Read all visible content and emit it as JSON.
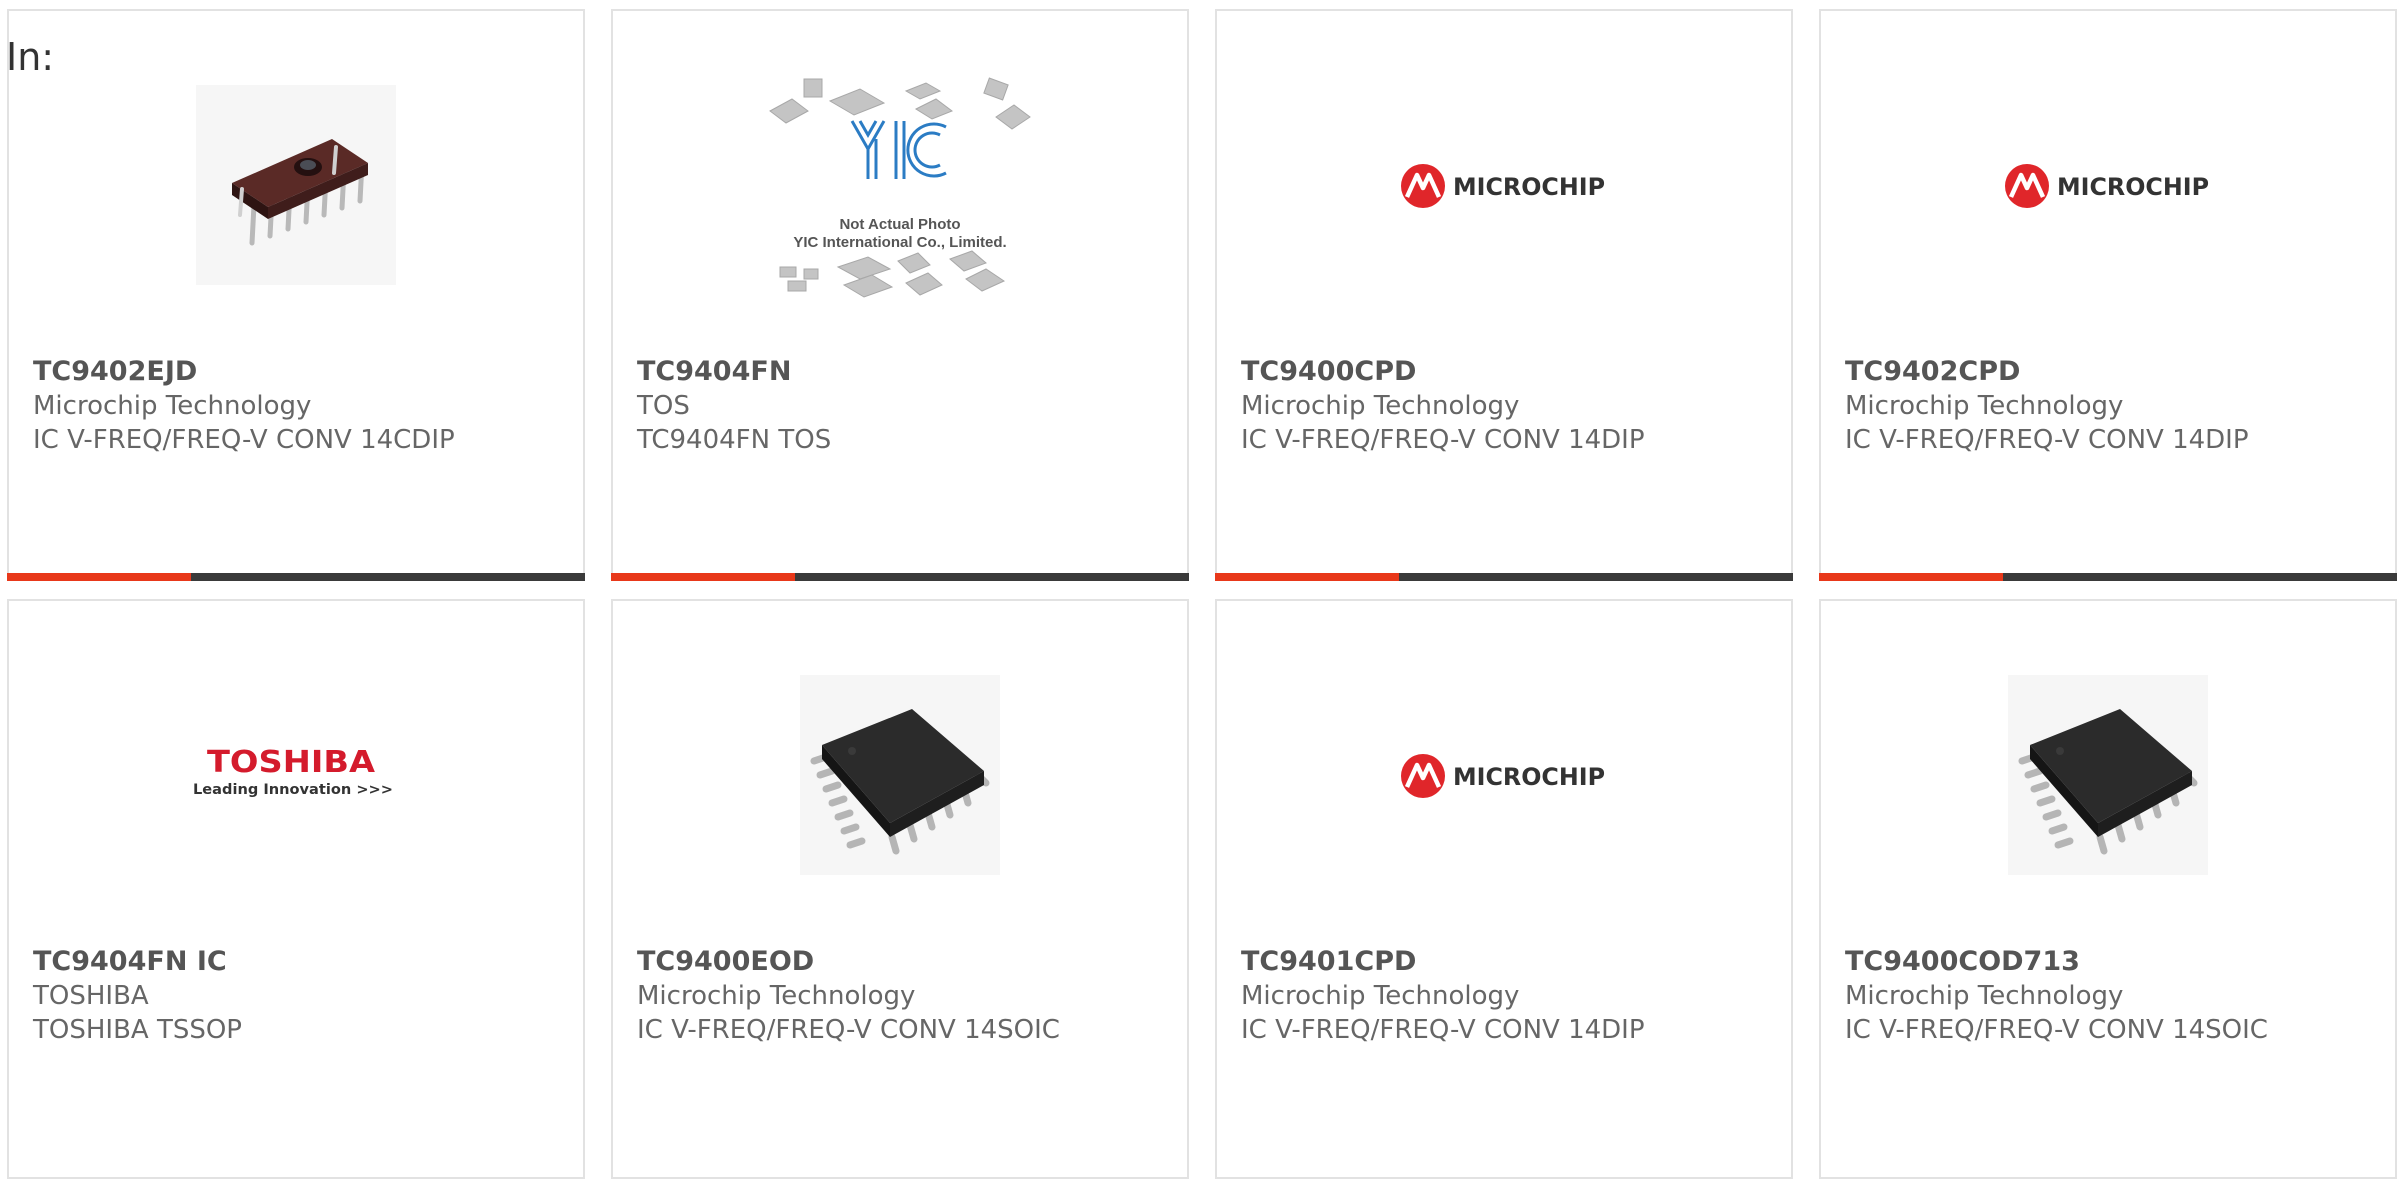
{
  "header": {
    "in_label": "In:"
  },
  "colors": {
    "accent": "#e8381a",
    "bar_dark": "#3a3a3a",
    "microchip_red": "#e0262a",
    "toshiba_red": "#d41b2c"
  },
  "products": [
    {
      "part": "TC9402EJD",
      "manufacturer": "Microchip Technology",
      "description": "IC V-FREQ/FREQ-V CONV 14CDIP",
      "image": "dip-chip-photo"
    },
    {
      "part": "TC9404FN",
      "manufacturer": "TOS",
      "description": "TC9404FN TOS",
      "image": "yic-placeholder",
      "placeholder_logo": "YIC",
      "placeholder_line1": "Not Actual Photo",
      "placeholder_line2": "YIC International Co., Limited."
    },
    {
      "part": "TC9400CPD",
      "manufacturer": "Microchip Technology",
      "description": "IC V-FREQ/FREQ-V CONV 14DIP",
      "image": "microchip-logo",
      "logo_text": "MICROCHIP"
    },
    {
      "part": "TC9402CPD",
      "manufacturer": "Microchip Technology",
      "description": "IC V-FREQ/FREQ-V CONV 14DIP",
      "image": "microchip-logo",
      "logo_text": "MICROCHIP"
    },
    {
      "part": "TC9404FN IC",
      "manufacturer": "TOSHIBA",
      "description": "TOSHIBA TSSOP",
      "image": "toshiba-logo",
      "logo_text": "TOSHIBA",
      "logo_tagline": "Leading Innovation >>>"
    },
    {
      "part": "TC9400EOD",
      "manufacturer": "Microchip Technology",
      "description": "IC V-FREQ/FREQ-V CONV 14SOIC",
      "image": "soic-chip-photo"
    },
    {
      "part": "TC9401CPD",
      "manufacturer": "Microchip Technology",
      "description": "IC V-FREQ/FREQ-V CONV 14DIP",
      "image": "microchip-logo",
      "logo_text": "MICROCHIP"
    },
    {
      "part": "TC9400COD713",
      "manufacturer": "Microchip Technology",
      "description": "IC V-FREQ/FREQ-V CONV 14SOIC",
      "image": "soic-chip-photo"
    }
  ]
}
